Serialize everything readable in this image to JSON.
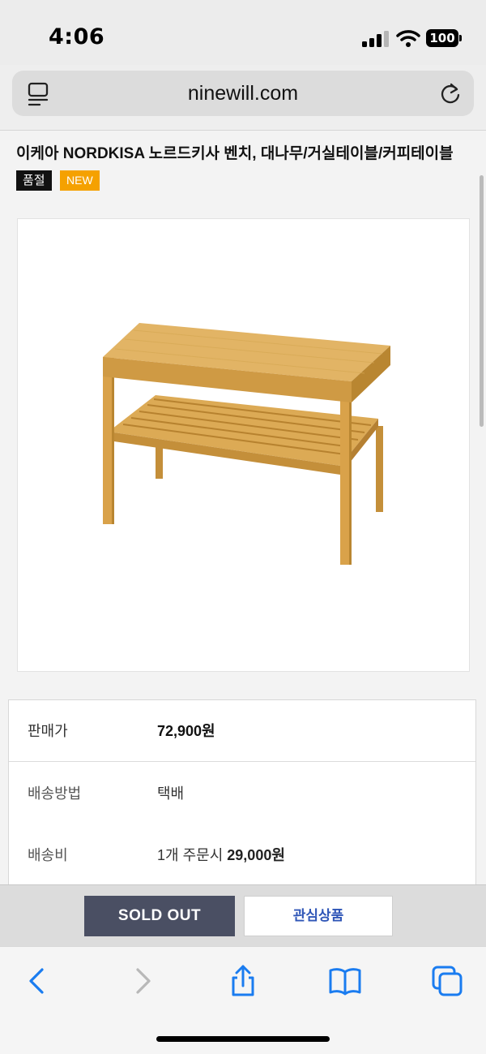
{
  "status_bar": {
    "time": "4:06",
    "battery": "100",
    "icons": [
      "signal-icon",
      "wifi-icon",
      "battery-icon"
    ]
  },
  "address_bar": {
    "url": "ninewill.com",
    "icons": [
      "reader-mode-icon",
      "reload-icon"
    ]
  },
  "product": {
    "title": "이케아 NORDKISA 노르드키사 벤치, 대나무/거실테이블/커피테이블",
    "badges": {
      "sold_out": "품절",
      "new": "NEW"
    },
    "image": "bamboo-bench-image"
  },
  "info": {
    "price_label": "판매가",
    "price_value": "72,900원",
    "method_label": "배송방법",
    "method_value": "택배",
    "fee_label": "배송비",
    "fee_prefix": "1개 주문시",
    "fee_amount": "29,000원"
  },
  "actions": {
    "sold_out_label": "SOLD OUT",
    "wishlist_label": "관심상품"
  },
  "toolbar": {
    "icons": [
      "back-icon",
      "forward-icon",
      "share-icon",
      "bookmarks-icon",
      "tabs-icon"
    ]
  },
  "colors": {
    "badge_sold_out": "#111111",
    "badge_new": "#f5a100",
    "sold_out_button": "#4a4f63",
    "wishlist_text": "#2f56b7",
    "safari_blue": "#1a7cf0"
  }
}
